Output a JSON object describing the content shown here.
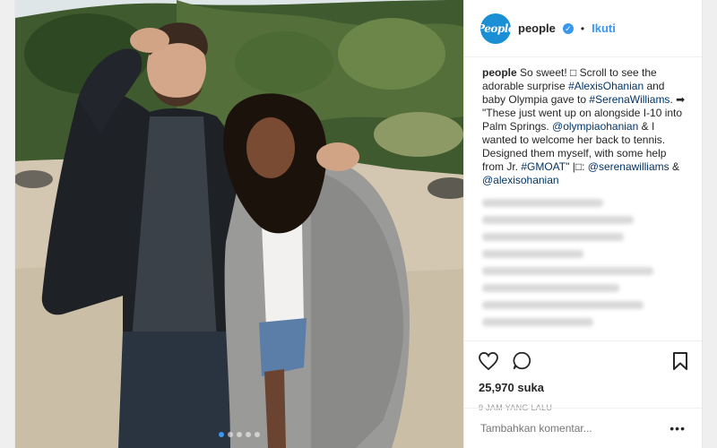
{
  "header": {
    "avatar_text": "People",
    "username": "people",
    "verified_glyph": "✓",
    "separator": "•",
    "follow_label": "Ikuti"
  },
  "caption": {
    "username": "people",
    "text_1": " So sweet! ",
    "glyph_1": "□",
    "text_2": " Scroll to see the adorable surprise ",
    "hashtag_1": "#AlexisOhanian",
    "text_3": " and baby Olympia gave to ",
    "hashtag_2": "#SerenaWilliams",
    "text_4": ". ➡ \"These just went up on alongside I-10 into Palm Springs. ",
    "mention_1": "@olympiaohanian",
    "text_5": " & I wanted to welcome her back to tennis. Designed them myself, with some help from Jr. ",
    "hashtag_3": "#GMOAT",
    "text_6": "\" |□: ",
    "mention_2": "@serenawilliams",
    "text_7": " & ",
    "mention_3": "@alexisohanian"
  },
  "actions": {
    "like_icon": "heart-icon",
    "comment_icon": "comment-icon",
    "save_icon": "bookmark-icon",
    "likes": "25,970 suka",
    "time": "9 JAM YANG LALU"
  },
  "comment_box": {
    "placeholder": "Tambahkan komentar...",
    "more_label": "•••"
  },
  "carousel": {
    "count": 5,
    "active_index": 0
  },
  "colors": {
    "accent": "#3897f0",
    "brand": "#1a8fd6",
    "text": "#262626"
  }
}
